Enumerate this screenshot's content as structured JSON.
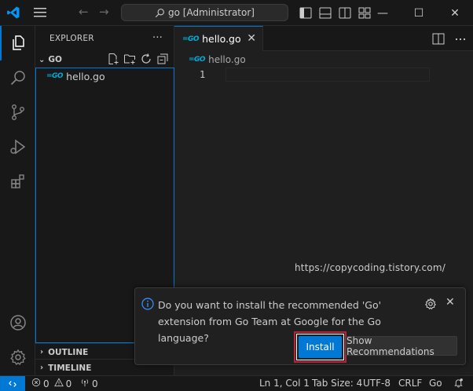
{
  "titlebar": {
    "search_text": "go [Administrator]",
    "minimize": "—",
    "maximize": "☐",
    "close": "✕",
    "back": "←",
    "forward": "→"
  },
  "activity_bar": {
    "icons": [
      "explorer-icon",
      "search-icon",
      "source-control-icon",
      "run-debug-icon",
      "extensions-icon",
      "account-icon",
      "settings-gear-icon"
    ]
  },
  "sidebar": {
    "title": "EXPLORER",
    "more": "···",
    "folder": "GO",
    "files": [
      {
        "name": "hello.go",
        "icon": "go-file-icon"
      }
    ],
    "sections": [
      "OUTLINE",
      "TIMELINE"
    ]
  },
  "editor": {
    "tab_label": "hello.go",
    "tab_close": "✕",
    "breadcrumb": "hello.go",
    "line_numbers": [
      "1"
    ],
    "watermark": "https://copycoding.tistory.com/"
  },
  "go_icon_text": "=GO",
  "notification": {
    "message": "Do you want to install the recommended 'Go' extension from Go Team at Google for the Go language?",
    "install_label": "Install",
    "show_label": "Show Recommendations",
    "close": "✕"
  },
  "statusbar": {
    "errors": "0",
    "warnings": "0",
    "ports": "0",
    "cursor": "Ln 1, Col 1",
    "tab_size": "Tab Size: 4",
    "encoding": "UTF-8",
    "eol": "CRLF",
    "language": "Go"
  },
  "colors": {
    "accent": "#0078d4",
    "background": "#1f1f1f",
    "chrome": "#181818",
    "highlight_box": "#b3263a",
    "go_blue": "#00acd7"
  }
}
